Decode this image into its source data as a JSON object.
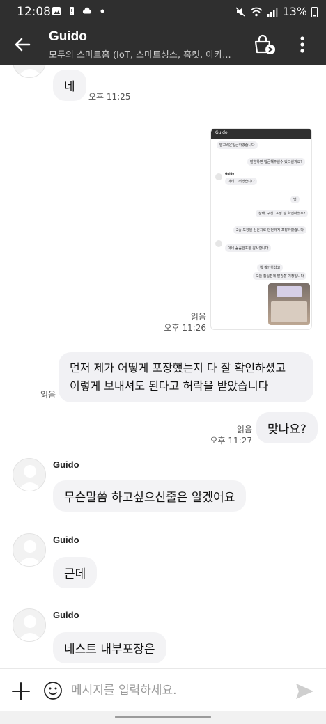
{
  "status": {
    "time": "12:08",
    "battery": "13%"
  },
  "header": {
    "title": "Guido",
    "subtitle": "모두의 스마트홈 (IoT, 스마트싱스, 홈킷, 아카..."
  },
  "messages": {
    "m1_text": "네",
    "m1_time": "오후 11:25",
    "img_read": "읽음",
    "img_time": "오후 11:26",
    "m2_line1": "먼저 제가 어떻게 포장했는지 다 잘 확인하셨고",
    "m2_line2": "이렇게 보내셔도 된다고 허락을 받았습니다",
    "m2_read": "읽음",
    "m3_text": "맞나요?",
    "m3_read": "읽음",
    "m3_time": "오후 11:27",
    "sender_name": "Guido",
    "m4_text": "무슨말씀 하고싶으신줄은 알겠어요",
    "m5_text": "근데",
    "m6_text": "네스트 내부포장은"
  },
  "shot": {
    "title": "Guido",
    "b1": "발고배운입금하였습니다",
    "b2": "발송하면 입금해주실수 있으실까요?",
    "b3": "아네 그러겠습니다",
    "b4": "넵",
    "b5": "상태, 구성, 포장 잘 확인하셨죠?",
    "b6": "2중 포장일 신문지로 안전하게 포장하였습니다",
    "b7": "아네 꼼꼼한포장 감사합니다",
    "b8": "뵘 확인하셨고",
    "b9": "오늘 집십점에 발송할 예정입니다",
    "sname": "Guido"
  },
  "input": {
    "placeholder": "메시지를 입력하세요."
  },
  "icons": {
    "back": "arrow-left-icon",
    "more": "more-vertical-icon",
    "plus": "plus-icon",
    "emoji": "emoji-icon",
    "send": "send-icon",
    "avatar": "default-avatar-icon"
  }
}
